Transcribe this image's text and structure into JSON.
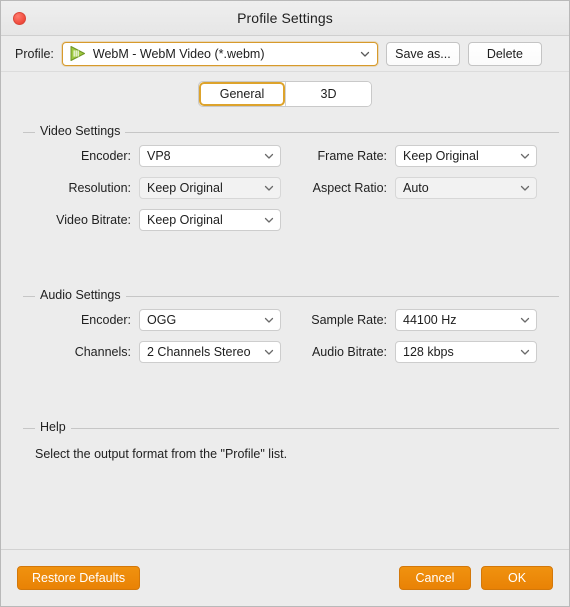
{
  "window": {
    "title": "Profile Settings",
    "close_icon": "close-icon"
  },
  "profile_bar": {
    "label": "Profile:",
    "icon": "webm-play-icon",
    "selected": "WebM - WebM Video (*.webm)",
    "save_as_label": "Save as...",
    "delete_label": "Delete"
  },
  "tabs": [
    {
      "label": "General",
      "active": true
    },
    {
      "label": "3D",
      "active": false
    }
  ],
  "video_settings": {
    "title": "Video Settings",
    "fields": [
      {
        "label": "Encoder:",
        "value": "VP8"
      },
      {
        "label": "Resolution:",
        "value": "Keep Original"
      },
      {
        "label": "Video Bitrate:",
        "value": "Keep Original"
      },
      {
        "label": "Frame Rate:",
        "value": "Keep Original"
      },
      {
        "label": "Aspect Ratio:",
        "value": "Auto"
      }
    ]
  },
  "audio_settings": {
    "title": "Audio Settings",
    "fields": [
      {
        "label": "Encoder:",
        "value": "OGG"
      },
      {
        "label": "Channels:",
        "value": "2 Channels Stereo"
      },
      {
        "label": "Sample Rate:",
        "value": "44100 Hz"
      },
      {
        "label": "Audio Bitrate:",
        "value": "128 kbps"
      }
    ]
  },
  "help": {
    "title": "Help",
    "text": "Select the output format from the \"Profile\" list."
  },
  "footer": {
    "restore_defaults_label": "Restore Defaults",
    "cancel_label": "Cancel",
    "ok_label": "OK"
  },
  "colors": {
    "accent_orange": "#ed8b08",
    "highlight_border": "#dda32c",
    "window_bg": "#ececec",
    "close_red": "#f04a3c",
    "icon_green": "#8cc63f"
  }
}
